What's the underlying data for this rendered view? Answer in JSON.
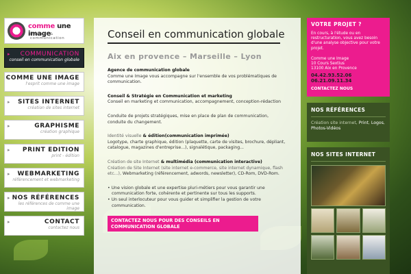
{
  "logo": {
    "name_part1": "comme",
    "name_part2": " une image",
    "tagline": "internet & communication"
  },
  "nav": [
    {
      "title": "COMMUNICATION",
      "sub": "conseil en communication globale",
      "active": true
    },
    {
      "title": "COMME UNE IMAGE",
      "sub": "l'esprit comme une image",
      "active": false
    },
    {
      "title": "SITES INTERNET",
      "sub": "création de sites internet",
      "active": false
    },
    {
      "title": "GRAPHISME",
      "sub": "création graphique",
      "active": false
    },
    {
      "title": "PRINT EDITION",
      "sub": "print - édition",
      "active": false
    },
    {
      "title": "WEBMARKETING",
      "sub": "référencement et webmarketing",
      "active": false
    },
    {
      "title": "NOS RÉFÉRENCES",
      "sub": "les références de comme une image",
      "active": false
    },
    {
      "title": "CONTACT",
      "sub": "contactez nous",
      "active": false
    }
  ],
  "main": {
    "title": "Conseil en communication globale",
    "subtitle": "Aix en provence – Marseille – Lyon",
    "agency_title": "Agence de communication globale",
    "agency_text": "Comme une Image vous accompagne sur l'ensemble de vos problématiques de communication.",
    "strategy_title": "Conseil & Stratégie en Communication et marketing",
    "strategy_text": "Conseil en marketing et communication, accompagnement, conception-rédaction",
    "projects_text": "Conduite de projets stratégiques, mise en place de plan de communication, conduite du changement.",
    "visual_title_a": "Identité visuelle",
    "visual_title_b": " & édition",
    "visual_title_c": "(communication imprimée)",
    "visual_text": "Logotype, charte graphique, édition (plaquette, carte de visites, brochure, dépliant, catalogue, magazines d'entreprise...), signalétique, packaging...",
    "web_title_a": "Création de site Internet",
    "web_title_b": " & multimédia (communication interactive)",
    "web_text_dim": "Création de Site Internet (site internet e-commerce, site internet dynamique, flash etc...), ",
    "web_text": "Webmarketing (référencement, adwords, newsletter), CD-Rom, DVD-Rom.",
    "bullet_1": "• Une vision globale et une expertise pluri-métiers pour vous garantir une communication forte, cohérente et pertinente sur tous les supports.",
    "bullet_2": "• Un seul interlocuteur pour vous guider et simplifier la gestion de votre communication.",
    "cta": "CONTACTEZ NOUS POUR DES CONSEILS EN COMMUNICATION GLOBALE"
  },
  "promo": {
    "title": "VOTRE PROJET ?",
    "text": "En cours, à l'étude ou en restructuration, vous avez besoin d'une analyse objective pour votre projet.",
    "addr_1": "Comme une Image",
    "addr_2": "10 Cours Sextius",
    "addr_3": "13100 Aix en Provence",
    "phone_1": "04.42.93.52.06",
    "phone_2": "06.21.09.11.34",
    "contact": "CONTACTEZ NOUS"
  },
  "refs": {
    "title": "NOS RÉFÉRENCES",
    "text_1": "Création site internet, ",
    "text_2": "Print",
    "text_3": ", ",
    "text_4": "Logos",
    "text_5": ", ",
    "text_6": "Photos-Vidéos"
  },
  "sites": {
    "title": "NOS SITES INTERNET"
  },
  "colors": {
    "accent": "#ec1c8e",
    "dark_panel": "#3a5223",
    "nav_active": "#21292e"
  }
}
